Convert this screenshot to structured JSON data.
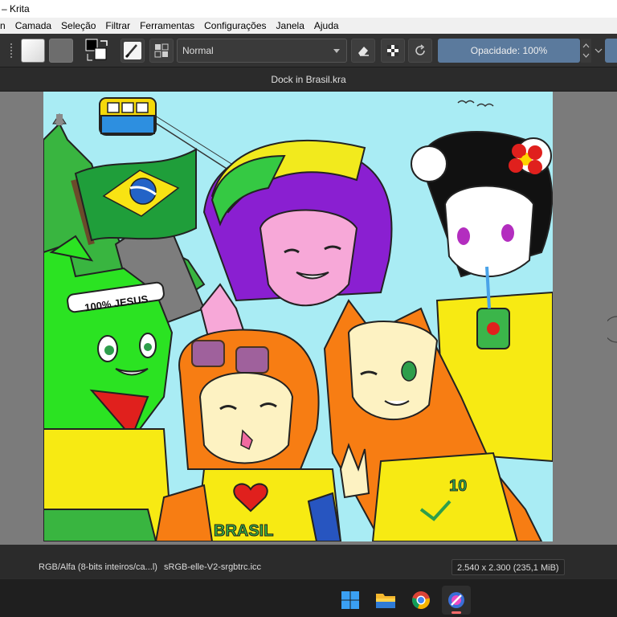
{
  "window": {
    "title": "– Krita"
  },
  "menu": [
    "n",
    "Camada",
    "Seleção",
    "Filtrar",
    "Ferramentas",
    "Configurações",
    "Janela",
    "Ajuda"
  ],
  "toolbar": {
    "blend_mode": "Normal",
    "opacity_label": "Opacidade: 100%",
    "accent_color": "#5b7a9d"
  },
  "document": {
    "title": "Dock in Brasil.kra"
  },
  "artwork": {
    "headband_text": "100% JESUS",
    "shirt_text": "BRASIL",
    "jersey_number": "10"
  },
  "status": {
    "color_model": "RGB/Alfa (8-bits inteiros/ca...l)",
    "color_profile": "sRGB-elle-V2-srgbtrc.icc",
    "image_size": "2.540 x 2.300 (235,1 MiB)"
  },
  "taskbar": {
    "icons": [
      "windows-start-icon",
      "file-explorer-icon",
      "chrome-icon",
      "krita-icon"
    ]
  }
}
